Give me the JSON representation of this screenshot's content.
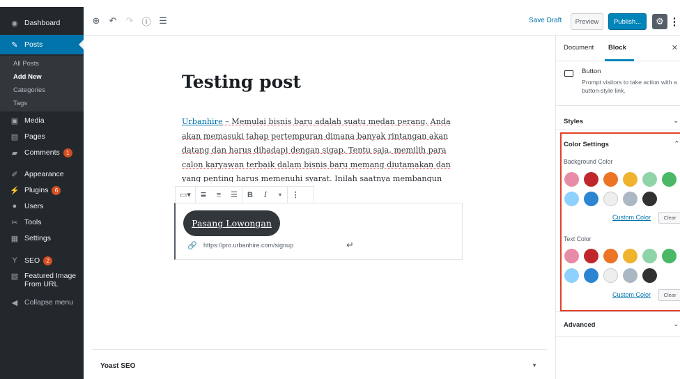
{
  "sidebar": {
    "dashboard": "Dashboard",
    "posts": "Posts",
    "posts_sub": [
      "All Posts",
      "Add New",
      "Categories",
      "Tags"
    ],
    "media": "Media",
    "pages": "Pages",
    "comments": "Comments",
    "comments_count": "1",
    "appearance": "Appearance",
    "plugins": "Plugins",
    "plugins_count": "6",
    "users": "Users",
    "tools": "Tools",
    "settings": "Settings",
    "seo": "SEO",
    "seo_count": "2",
    "featured_line1": "Featured Image",
    "featured_line2": "From URL",
    "collapse": "Collapse menu"
  },
  "toolbar": {
    "save_draft": "Save Draft",
    "preview": "Preview",
    "publish": "Publish..."
  },
  "editor": {
    "title": "Testing post",
    "link_word": "Urbanhire",
    "paragraph": " – Memulai bisnis baru adalah suatu medan perang. Anda akan memasuki tahap pertempuran dimana banyak rintangan akan datang dan harus dihadapi dengan sigap. Tentu saja, memilih para calon karyawan terbaik dalam bisnis baru memang diutamakan dan yang penting harus memenuhi syarat. Inilah saatnya membangun tim perekrutan yang Anda",
    "button_text": "Pasang Lowongan",
    "button_url": "https://pro.urbanhire.com/signup",
    "yoast": "Yoast SEO"
  },
  "panel": {
    "tab_document": "Document",
    "tab_block": "Block",
    "block_name": "Button",
    "block_desc": "Prompt visitors to take action with a button-style link.",
    "styles": "Styles",
    "color_settings": "Color Settings",
    "bg_color": "Background Color",
    "text_color": "Text Color",
    "custom_color": "Custom Color",
    "clear": "Clear",
    "advanced": "Advanced"
  },
  "palette": [
    "#e88ba6",
    "#c0272d",
    "#ec7427",
    "#f0b32d",
    "#8fd4a8",
    "#4ab866",
    "#8ed1fc",
    "#2c85d1",
    "#eeeeee",
    "#abb8c3",
    "#313131"
  ]
}
